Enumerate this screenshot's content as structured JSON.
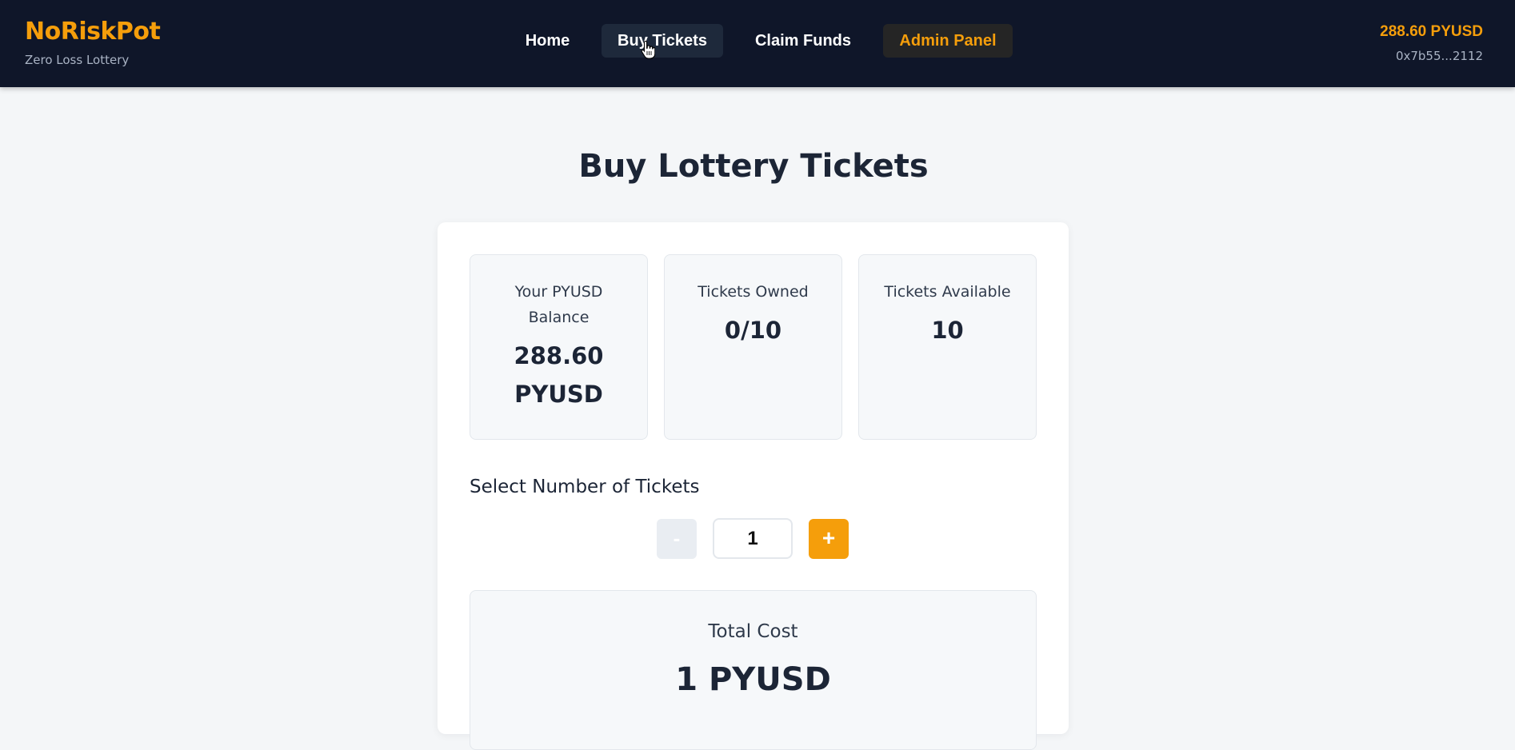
{
  "header": {
    "brand_name": "NoRiskPot",
    "tagline": "Zero Loss Lottery",
    "nav": [
      {
        "label": "Home"
      },
      {
        "label": "Buy Tickets",
        "active": true
      },
      {
        "label": "Claim Funds"
      },
      {
        "label": "Admin Panel"
      }
    ],
    "wallet": {
      "balance": "288.60 PYUSD",
      "address": "0x7b55...2112"
    }
  },
  "main": {
    "title": "Buy Lottery Tickets",
    "stats": [
      {
        "label": "Your PYUSD Balance",
        "value": "288.60 PYUSD"
      },
      {
        "label": "Tickets Owned",
        "value": "0/10"
      },
      {
        "label": "Tickets Available",
        "value": "10"
      }
    ],
    "select_label": "Select Number of Tickets",
    "stepper": {
      "minus": "-",
      "value": "1",
      "plus": "+"
    },
    "total": {
      "label": "Total Cost",
      "value": "1 PYUSD"
    }
  },
  "colors": {
    "navbar_bg": "#0f1629",
    "accent": "#f59e0b",
    "page_bg": "#f4f6f8",
    "card_bg": "#ffffff"
  }
}
